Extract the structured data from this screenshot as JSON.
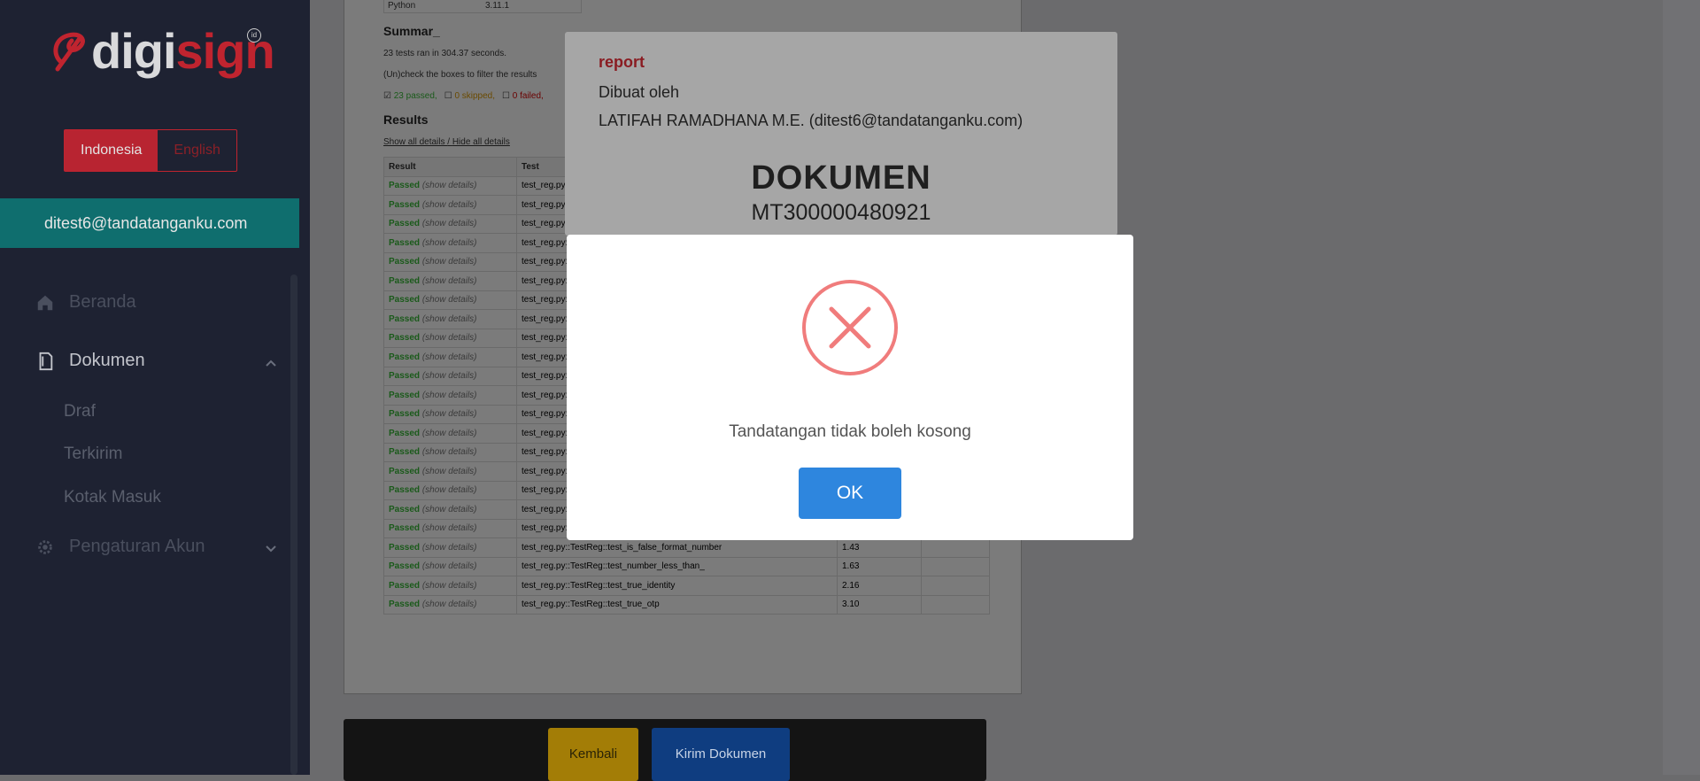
{
  "brand": {
    "logo_part1": "digi",
    "logo_part2": "sign",
    "logo_badge": "id"
  },
  "language": {
    "active": "Indonesia",
    "inactive": "English"
  },
  "user": {
    "email": "ditest6@tandatanganku.com"
  },
  "nav": {
    "beranda": "Beranda",
    "dokumen": "Dokumen",
    "draf": "Draf",
    "terkirim": "Terkirim",
    "kotak_masuk": "Kotak Masuk",
    "pengaturan": "Pengaturan Akun"
  },
  "icons": {
    "home": "home-icon",
    "document": "document-icon",
    "gear": "gear-icon",
    "chevron_up": "chevron-up-icon",
    "chevron_down": "chevron-down-icon",
    "error": "error-x-icon"
  },
  "colors": {
    "brand_red": "#c0242f",
    "teal": "#0f6e6e",
    "sidebar": "#1e2232",
    "ok_button": "#2e86de",
    "error": "#f07c7c",
    "kembali": "#a37d06",
    "kirim": "#0f3d80"
  },
  "report_doc": {
    "python_label": "Python",
    "python_version": "3.11.1",
    "summary_title": "Summar_",
    "summary_line": "23 tests ran in 304.37 seconds.",
    "filter_hint": "(Un)check the boxes to filter the results",
    "filter_passed": "23 passed,",
    "filter_skipped": "0 skipped,",
    "filter_failed": "0 failed,",
    "results_title": "Results",
    "show_all": "Show all details",
    "separator": "/",
    "hide_all": "Hide all details",
    "columns": [
      "Result",
      "Test",
      "",
      ""
    ],
    "rows": [
      {
        "result": "Passed",
        "details": "(show details)",
        "test": "test_reg.py::TestReg::test_",
        "duration": "",
        "links": ""
      },
      {
        "result": "Passed",
        "details": "(show details)",
        "test": "test_reg.py::TestReg::test_",
        "duration": "",
        "links": ""
      },
      {
        "result": "Passed",
        "details": "(show details)",
        "test": "test_reg.py::TestReg::test_",
        "duration": "",
        "links": ""
      },
      {
        "result": "Passed",
        "details": "(show details)",
        "test": "test_reg.py::TestReg::test_",
        "duration": "",
        "links": ""
      },
      {
        "result": "Passed",
        "details": "(show details)",
        "test": "test_reg.py::TestReg::test_",
        "duration": "",
        "links": ""
      },
      {
        "result": "Passed",
        "details": "(show details)",
        "test": "test_reg.py::TestReg::test_",
        "duration": "",
        "links": ""
      },
      {
        "result": "Passed",
        "details": "(show details)",
        "test": "test_reg.py::TestReg::test_",
        "duration": "",
        "links": ""
      },
      {
        "result": "Passed",
        "details": "(show details)",
        "test": "test_reg.py::TestReg::test_",
        "duration": "",
        "links": ""
      },
      {
        "result": "Passed",
        "details": "(show details)",
        "test": "test_reg.py::TestReg::test_",
        "duration": "",
        "links": ""
      },
      {
        "result": "Passed",
        "details": "(show details)",
        "test": "test_reg.py::TestReg::test_",
        "duration": "",
        "links": ""
      },
      {
        "result": "Passed",
        "details": "(show details)",
        "test": "test_reg.py::TestReg::test_",
        "duration": "",
        "links": ""
      },
      {
        "result": "Passed",
        "details": "(show details)",
        "test": "test_reg.py::TestReg::test_",
        "duration": "",
        "links": ""
      },
      {
        "result": "Passed",
        "details": "(show details)",
        "test": "test_reg.py::TestReg::test_",
        "duration": "",
        "links": ""
      },
      {
        "result": "Passed",
        "details": "(show details)",
        "test": "test_reg.py::TestReg::test_",
        "duration": "",
        "links": ""
      },
      {
        "result": "Passed",
        "details": "(show details)",
        "test": "test_reg.py::TestReg::test_",
        "duration": "",
        "links": ""
      },
      {
        "result": "Passed",
        "details": "(show details)",
        "test": "test_reg.py::TestReg::test_",
        "duration": "",
        "links": ""
      },
      {
        "result": "Passed",
        "details": "(show details)",
        "test": "test_reg.py::TestReg::test_",
        "duration": "",
        "links": ""
      },
      {
        "result": "Passed",
        "details": "(show details)",
        "test": "test_reg.py::TestReg::test_",
        "duration": "",
        "links": ""
      },
      {
        "result": "Passed",
        "details": "(show details)",
        "test": "test_reg.py::TestReg::test_",
        "duration": "",
        "links": ""
      },
      {
        "result": "Passed",
        "details": "(show details)",
        "test": "test_reg.py::TestReg::test_is_false_format_number",
        "duration": "1.43",
        "links": ""
      },
      {
        "result": "Passed",
        "details": "(show details)",
        "test": "test_reg.py::TestReg::test_number_less_than_",
        "duration": "1.63",
        "links": ""
      },
      {
        "result": "Passed",
        "details": "(show details)",
        "test": "test_reg.py::TestReg::test_true_identity",
        "duration": "2.16",
        "links": ""
      },
      {
        "result": "Passed",
        "details": "(show details)",
        "test": "test_reg.py::TestReg::test_true_otp",
        "duration": "3.10",
        "links": ""
      }
    ]
  },
  "info_card": {
    "title": "report",
    "created_by_label": "Dibuat oleh",
    "creator": "LATIFAH RAMADHANA M.E. (ditest6@tandatanganku.com)",
    "doc_label": "DOKUMEN",
    "doc_number": "MT300000480921"
  },
  "footer": {
    "back": "Kembali",
    "send": "Kirim Dokumen"
  },
  "modal": {
    "message": "Tandatangan tidak boleh kosong",
    "ok": "OK"
  }
}
